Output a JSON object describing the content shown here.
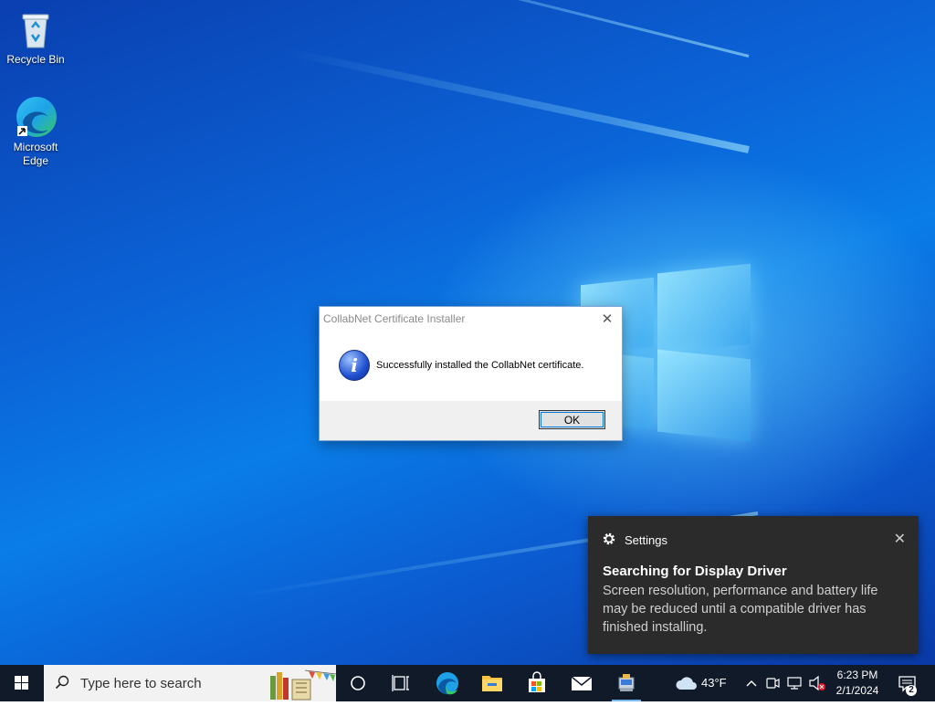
{
  "desktop": {
    "icons": [
      {
        "label": "Recycle Bin",
        "icon": "recycle-bin-icon"
      },
      {
        "label": "Microsoft Edge",
        "icon": "edge-icon"
      }
    ]
  },
  "dialog": {
    "title": "CollabNet Certificate Installer",
    "message": "Successfully installed the CollabNet certificate.",
    "ok_label": "OK",
    "icon": "info-icon"
  },
  "toast": {
    "app": "Settings",
    "title": "Searching for Display Driver",
    "body": "Screen resolution, performance and battery life may be reduced until a compatible driver has finished installing."
  },
  "taskbar": {
    "search_placeholder": "Type here to search",
    "pinned": [
      "cortana-icon",
      "task-view-icon",
      "edge-icon",
      "file-explorer-icon",
      "store-icon",
      "mail-icon",
      "installer-icon"
    ],
    "weather": {
      "temp": "43°F",
      "icon": "cloud-icon"
    },
    "time": "6:23 PM",
    "date": "2/1/2024",
    "notification_count": "2"
  },
  "colors": {
    "taskbar": "#101a29",
    "toast_bg": "#2b2b2b",
    "accent": "#0078d7"
  }
}
